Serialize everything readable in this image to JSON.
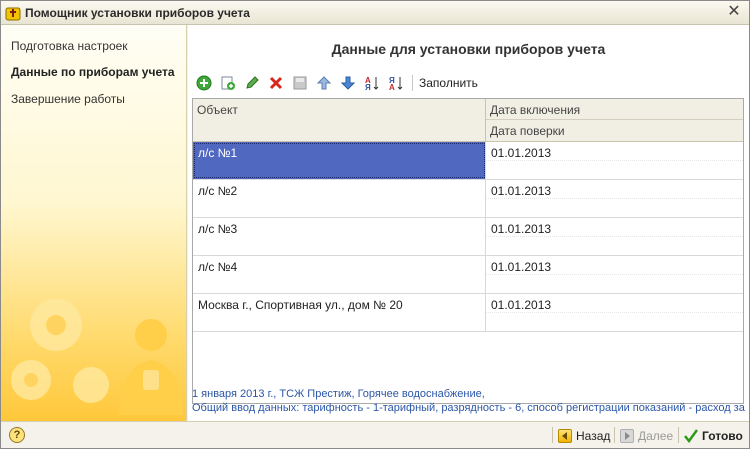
{
  "window": {
    "title": "Помощник установки приборов учета"
  },
  "steps": [
    {
      "label": "Подготовка настроек",
      "active": false
    },
    {
      "label": "Данные по приборам учета",
      "active": true
    },
    {
      "label": "Завершение работы",
      "active": false
    }
  ],
  "main": {
    "heading": "Данные для установки приборов учета",
    "toolbar": {
      "buttons": [
        "add-icon",
        "copy-icon",
        "edit-icon",
        "delete-icon",
        "save-icon",
        "move-up-icon",
        "move-down-icon",
        "sort-asc-icon",
        "sort-desc-icon"
      ],
      "fill_label": "Заполнить"
    },
    "table": {
      "columns": {
        "object": "Объект",
        "date_on": "Дата включения",
        "date_check": "Дата поверки"
      },
      "rows": [
        {
          "object": "л/с №1",
          "date_on": "01.01.2013",
          "date_check": "",
          "selected": true
        },
        {
          "object": "л/с №2",
          "date_on": "01.01.2013",
          "date_check": "",
          "selected": false
        },
        {
          "object": "л/с №3",
          "date_on": "01.01.2013",
          "date_check": "",
          "selected": false
        },
        {
          "object": "л/с №4",
          "date_on": "01.01.2013",
          "date_check": "",
          "selected": false
        },
        {
          "object": "Москва г., Спортивная ул., дом № 20",
          "date_on": "01.01.2013",
          "date_check": "",
          "selected": false
        }
      ]
    },
    "info_line1": "1 января 2013 г., ТСЖ Престиж, Горячее водоснабжение,",
    "info_line2": "Общий ввод данных: тарифность - 1-тарифный, разрядность - 6, способ регистрации показаний - расход за"
  },
  "footer": {
    "help": "?",
    "back_label": "Назад",
    "next_label": "Далее",
    "done_label": "Готово"
  },
  "colors": {
    "selection": "#5068c0",
    "info_text": "#2b56a8",
    "accent_yellow": "#ffc83b"
  }
}
